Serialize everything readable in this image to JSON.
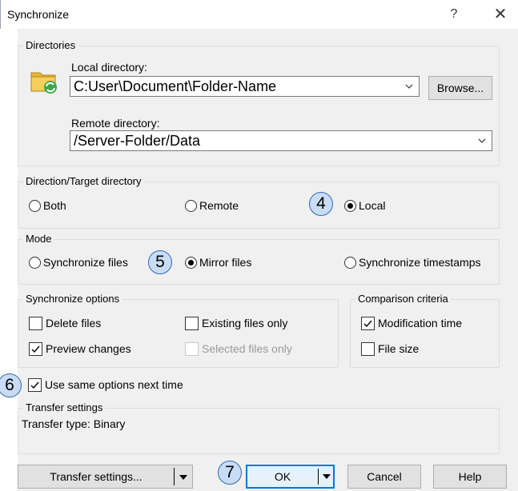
{
  "window": {
    "title": "Synchronize",
    "help_glyph": "?",
    "close_glyph": "✕"
  },
  "directories": {
    "legend": "Directories",
    "local_label": "Local directory:",
    "local_value": "C:User\\Document\\Folder-Name",
    "browse_label": "Browse...",
    "remote_label": "Remote directory:",
    "remote_value": "/Server-Folder/Data",
    "folder_icon": "folder-sync-icon"
  },
  "direction": {
    "legend": "Direction/Target directory",
    "options": [
      "Both",
      "Remote",
      "Local"
    ],
    "selected": "Local"
  },
  "mode": {
    "legend": "Mode",
    "options": [
      "Synchronize files",
      "Mirror files",
      "Synchronize timestamps"
    ],
    "selected": "Mirror files"
  },
  "sync_options": {
    "legend": "Synchronize options",
    "delete_files": {
      "label": "Delete files",
      "checked": false
    },
    "existing_only": {
      "label": "Existing files only",
      "checked": false
    },
    "preview_changes": {
      "label": "Preview changes",
      "checked": true
    },
    "selected_only": {
      "label": "Selected files only",
      "checked": false,
      "disabled": true
    }
  },
  "comparison": {
    "legend": "Comparison criteria",
    "modification_time": {
      "label": "Modification time",
      "checked": true
    },
    "file_size": {
      "label": "File size",
      "checked": false
    }
  },
  "use_same": {
    "label": "Use same options next time",
    "checked": true
  },
  "transfer": {
    "legend": "Transfer settings",
    "type_text": "Transfer type: Binary"
  },
  "buttons": {
    "transfer_settings": "Transfer settings...",
    "ok": "OK",
    "cancel": "Cancel",
    "help": "Help"
  },
  "callouts": [
    "4",
    "5",
    "6",
    "7"
  ],
  "colors": {
    "callout_fill": "#c9dcf5",
    "callout_border": "#2e6bb7",
    "dialog_bg": "#f0f0f0"
  }
}
